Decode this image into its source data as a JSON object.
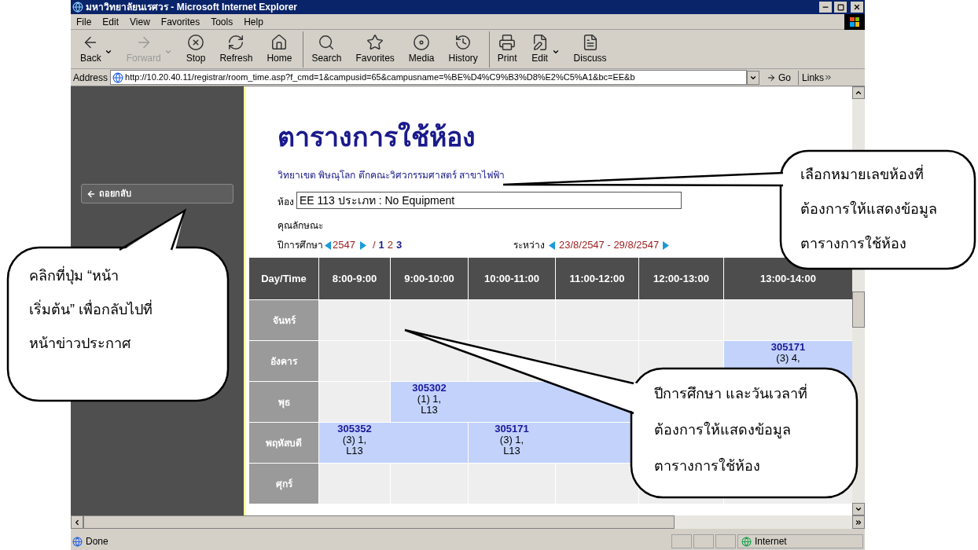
{
  "window": {
    "title": "มหาวิทยาลัยนเรศวร - Microsoft Internet Explorer"
  },
  "menu": [
    "File",
    "Edit",
    "View",
    "Favorites",
    "Tools",
    "Help"
  ],
  "toolbar": [
    {
      "buttons": [
        {
          "label": "Back",
          "kind": "back",
          "disabled": false,
          "dropdown": true
        },
        {
          "label": "Forward",
          "kind": "forward",
          "disabled": true,
          "dropdown": true
        },
        {
          "label": "Stop",
          "kind": "stop",
          "disabled": false,
          "dropdown": false
        },
        {
          "label": "Refresh",
          "kind": "refresh",
          "disabled": false,
          "dropdown": false
        },
        {
          "label": "Home",
          "kind": "home",
          "disabled": false,
          "dropdown": false
        }
      ]
    },
    {
      "buttons": [
        {
          "label": "Search",
          "kind": "search",
          "disabled": false,
          "dropdown": false
        },
        {
          "label": "Favorites",
          "kind": "favorites",
          "disabled": false,
          "dropdown": false
        },
        {
          "label": "Media",
          "kind": "media",
          "disabled": false,
          "dropdown": false
        },
        {
          "label": "History",
          "kind": "history",
          "disabled": false,
          "dropdown": false
        }
      ]
    },
    {
      "buttons": [
        {
          "label": "Print",
          "kind": "print",
          "disabled": false,
          "dropdown": false
        },
        {
          "label": "Edit",
          "kind": "edit",
          "disabled": false,
          "dropdown": true
        },
        {
          "label": "Discuss",
          "kind": "discuss",
          "disabled": false,
          "dropdown": false
        }
      ]
    }
  ],
  "address_bar": {
    "label": "Address",
    "value": "http://10.20.40.11/registrar/room_time.asp?f_cmd=1&campusid=65&campusname=%BE%D4%C9%B3%D8%E2%C5%A1&bc=EE&b",
    "go": "Go",
    "links": "Links"
  },
  "sidebar": {
    "back_button": "ถอยกลับ"
  },
  "page": {
    "title": "ตารางการใช้ห้อง",
    "location": "วิทยาเขต พิษณุโลก ตึกคณะวิศวกรรมศาสตร์ สาขาไฟฟ้า",
    "room_label": "ห้อง",
    "room_value": "EE 113 ประเภท : No Equipment",
    "features_label": "คุณลักษณะ",
    "year_label": "ปีการศึกษา",
    "year": "2547",
    "slash": "/",
    "semesters": [
      {
        "label": "1",
        "selected": false
      },
      {
        "label": "2",
        "selected": true
      },
      {
        "label": "3",
        "selected": false
      }
    ],
    "range_label": "ระหว่าง",
    "range": "23/8/2547 - 29/8/2547"
  },
  "table": {
    "columns": [
      "Day/Time",
      "8:00-9:00",
      "9:00-10:00",
      "10:00-11:00",
      "11:00-12:00",
      "12:00-13:00",
      "13:00-14:00"
    ],
    "rows": [
      {
        "cells": [
          {
            "kind": "day",
            "text": "จันทร์"
          },
          {
            "kind": "empty"
          },
          {
            "kind": "empty"
          },
          {
            "kind": "empty"
          },
          {
            "kind": "empty"
          },
          {
            "kind": "empty"
          },
          {
            "kind": "empty"
          }
        ]
      },
      {
        "cells": [
          {
            "kind": "day",
            "text": "อังคาร"
          },
          {
            "kind": "empty"
          },
          {
            "kind": "empty"
          },
          {
            "kind": "empty"
          },
          {
            "kind": "empty"
          },
          {
            "kind": "empty"
          },
          {
            "kind": "booking",
            "code": "305171",
            "lines": [
              "(3) 4,"
            ]
          }
        ]
      },
      {
        "cells": [
          {
            "kind": "day",
            "text": "พุธ"
          },
          {
            "kind": "empty"
          },
          {
            "kind": "booking",
            "code": "305302",
            "lines": [
              "(1) 1,",
              "L13"
            ]
          },
          {
            "kind": "continued"
          },
          {
            "kind": "continued"
          }
        ]
      },
      {
        "cells": [
          {
            "kind": "day",
            "text": "พฤหัสบดี"
          },
          {
            "kind": "booking",
            "code": "305352",
            "lines": [
              "(3) 1,",
              "L13"
            ]
          },
          {
            "kind": "continued"
          },
          {
            "kind": "booking",
            "code": "305171",
            "lines": [
              "(3) 1,",
              "L13"
            ]
          },
          {
            "kind": "continued"
          }
        ]
      },
      {
        "cells": [
          {
            "kind": "day",
            "text": "ศุกร์"
          },
          {
            "kind": "empty"
          },
          {
            "kind": "empty"
          },
          {
            "kind": "empty"
          },
          {
            "kind": "empty"
          },
          {
            "kind": "empty"
          },
          {
            "kind": "empty"
          }
        ]
      }
    ]
  },
  "status_bar": {
    "text": "Done",
    "zone": "Internet"
  },
  "callouts": [
    {
      "lines": [
        "คลิกที่ปุ่ม “หน้า",
        "เริ่มต้น” เพื่อกลับไปที่",
        "หน้าข่าวประกาศ"
      ]
    },
    {
      "lines": [
        "เลือกหมายเลขห้องที่",
        "ต้องการให้แสดงข้อมูล",
        "ตารางการใช้ห้อง"
      ]
    },
    {
      "lines": [
        "ปีการศึกษา และวันเวลาที่",
        "ต้องการให้แสดงข้อมูล",
        "ตารางการใช้ห้อง"
      ]
    }
  ]
}
